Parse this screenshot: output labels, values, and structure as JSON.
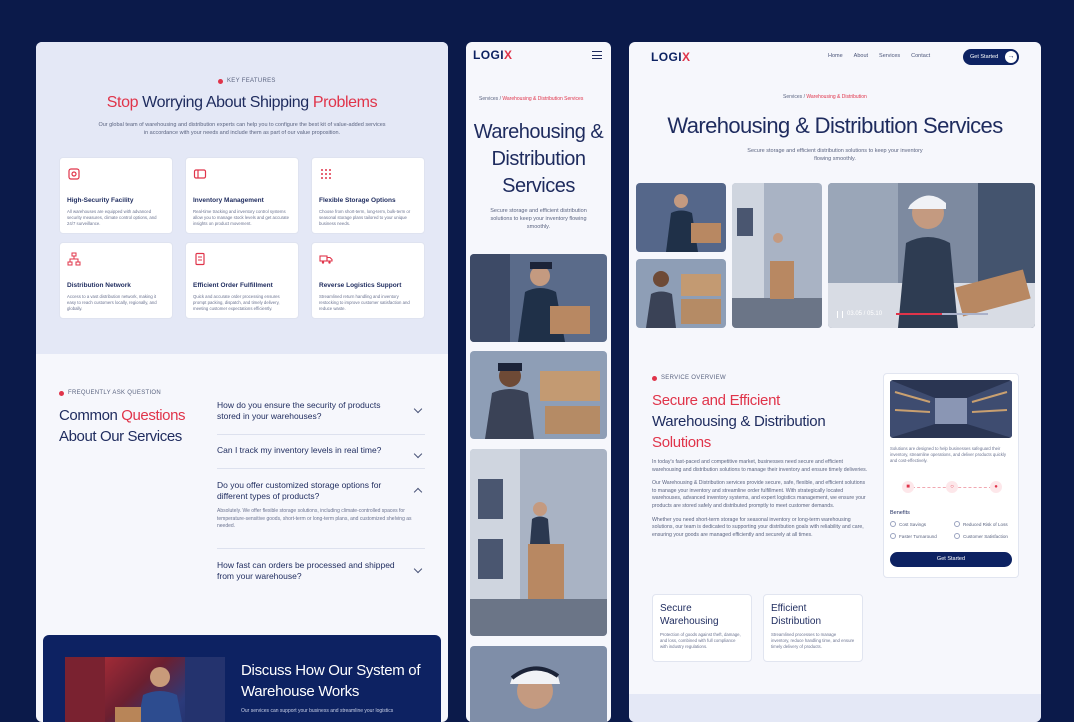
{
  "brand": {
    "logo_main": "LOGI",
    "logo_x": "X"
  },
  "left": {
    "kicker": "KEY FEATURES",
    "title_a": "Stop",
    "title_b": " Worrying About Shipping ",
    "title_c": "Problems",
    "subtitle": "Our global team of warehousing and distribution experts can help you to configure the best kit of value-added services in accordance with your needs and include them as part of our value proposition.",
    "features": [
      {
        "title": "High-Security Facility",
        "desc": "All warehouses are equipped with advanced security measures, climate control options, and 24/7 surveillance."
      },
      {
        "title": "Inventory Management",
        "desc": "Real-time tracking and inventory control systems allow you to manage stock levels and get accurate insights on product movement."
      },
      {
        "title": "Flexible Storage Options",
        "desc": "Choose from short-term, long-term, bulk-term or seasonal storage plans tailored to your unique business needs."
      },
      {
        "title": "Distribution Network",
        "desc": "Access to a vast distribution network, making it easy to reach customers locally, regionally, and globally."
      },
      {
        "title": "Efficient Order Fulfillment",
        "desc": "Quick and accurate order processing ensures prompt packing, dispatch, and timely delivery, meeting customer expectations efficiently."
      },
      {
        "title": "Reverse Logistics Support",
        "desc": "Streamlined return handling and inventory restocking to improve customer satisfaction and reduce waste."
      }
    ],
    "faq_kicker": "FREQUENTLY ASK QUESTION",
    "faq_title_a": "Common ",
    "faq_title_b": "Questions",
    "faq_title_c": "About Our Services",
    "faqs": [
      {
        "q": "How do you ensure the security of products stored in your warehouses?"
      },
      {
        "q": "Can I track my inventory levels in real time?"
      },
      {
        "q": "Do you offer customized storage options for different types of products?",
        "a": "Absolutely. We offer flexible storage solutions, including climate-controlled spaces for temperature-sensitive goods, short-term or long-term plans, and customized shelving as needed."
      },
      {
        "q": "How fast can orders be processed and shipped from your warehouse?"
      }
    ],
    "cta_title": "Discuss How Our System of Warehouse Works",
    "cta_desc": "Our services can support your business and streamline your logistics"
  },
  "mobile": {
    "crumb_home": "Services",
    "crumb_sep": "/",
    "crumb_current": "Warehousing & Distribution Services",
    "title": "Warehousing & Distribution Services",
    "subtitle": "Secure storage and efficient distribution solutions to keep your inventory flowing smoothly."
  },
  "desktop": {
    "nav": [
      "Home",
      "About",
      "Services",
      "Contact"
    ],
    "cta_button": "Get Started",
    "crumb_home": "Services",
    "crumb_sep": "/",
    "crumb_current": "Warehousing & Distribution",
    "title": "Warehousing & Distribution Services",
    "subtitle": "Secure storage and efficient distribution solutions to keep your inventory flowing smoothly.",
    "video_time": "03.05 / 05.10",
    "video_progress": 0.5,
    "overview_kicker": "SERVICE OVERVIEW",
    "overview_a": "Secure and Efficient",
    "overview_b": "Warehousing & Distribution",
    "overview_c": "Solutions",
    "paragraphs": [
      "In today's fast-paced and competitive market, businesses need secure and efficient warehousing and distribution solutions to manage their inventory and ensure timely deliveries.",
      "Our Warehousing & Distribution services provide secure, safe, flexible, and efficient solutions to manage your inventory and streamline order fulfillment. With strategically located warehouses, advanced inventory systems, and expert logistics management, we ensure your products are stored safely and distributed promptly to meet customer demands.",
      "Whether you need short-term storage for seasonal inventory or long-term warehousing solutions, our team is dedicated to supporting your distribution goals with reliability and care, ensuring your goods are managed efficiently and securely at all times."
    ],
    "cards": [
      {
        "title": "Secure Warehousing",
        "desc": "Protection of goods against theft, damage, and loss, combined with full compliance with industry regulations."
      },
      {
        "title": "Efficient Distribution",
        "desc": "Streamlined processes to manage inventory, reduce handling time, and ensure timely delivery of products."
      }
    ],
    "side_desc": "Solutions are designed to help businesses safeguard their inventory, streamline operations, and deliver products quickly and cost-effectively.",
    "benefits_title": "Benefits",
    "benefits": [
      "Cost Savings",
      "Reduced Risk of Loss",
      "Faster Turnaround",
      "Customer Satisfaction"
    ],
    "side_button": "Get Started"
  },
  "colors": {
    "accent": "#e0344a",
    "navy": "#0d2262",
    "background": "#0b1a4a"
  }
}
